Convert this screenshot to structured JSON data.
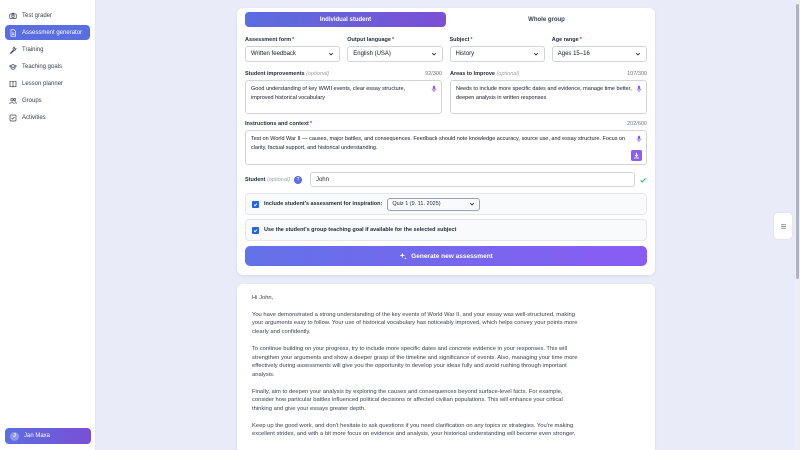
{
  "sidebar": {
    "items": [
      {
        "label": "Test grader",
        "icon": "camera-icon",
        "active": false
      },
      {
        "label": "Assessment generator",
        "icon": "document-icon",
        "active": true
      },
      {
        "label": "Training",
        "icon": "wrench-icon",
        "active": false
      },
      {
        "label": "Teaching goals",
        "icon": "graduation-cap-icon",
        "active": false
      },
      {
        "label": "Lesson planner",
        "icon": "book-icon",
        "active": false
      },
      {
        "label": "Groups",
        "icon": "users-icon",
        "active": false
      },
      {
        "label": "Activities",
        "icon": "checkbox-icon",
        "active": false
      }
    ],
    "user": {
      "initial": "J",
      "name": "Jan Maxa"
    }
  },
  "form": {
    "tabs": [
      {
        "label": "Individual student",
        "active": true
      },
      {
        "label": "Whole group",
        "active": false
      }
    ],
    "assessment_form": {
      "label": "Assessment form",
      "value": "Written feedback"
    },
    "output_language": {
      "label": "Output language",
      "value": "English (USA)"
    },
    "subject": {
      "label": "Subject",
      "value": "History"
    },
    "age_range": {
      "label": "Age range",
      "value": "Ages 15–16"
    },
    "required_mark": "*",
    "optional_mark": "(optional)",
    "improvements": {
      "label": "Student improvements",
      "count": "92/300",
      "value": "Good understanding of key WWII events, clear essay structure, improved historical vocabulary"
    },
    "areas": {
      "label": "Areas to Improve",
      "count": "107/300",
      "value": "Needs to include more specific dates and evidence, manage time better, deepen analysis in written responses"
    },
    "instructions": {
      "label": "Instructions and context",
      "count": "202/600",
      "value": "Test on World War II — causes, major battles, and consequences. Feedback should note knowledge accuracy, source use, and essay structure. Focus on clarity, factual support, and historical understanding."
    },
    "student": {
      "label": "Student",
      "value": "John",
      "help": "?"
    },
    "include_assessment": {
      "label": "Include student's assessment for inspiration:",
      "quiz": "Quiz 1 (9. 11. 2025)"
    },
    "group_goal": {
      "label": "Use the student's group teaching goal if available for the selected subject"
    },
    "generate_label": "Generate new assessment"
  },
  "result": {
    "greeting": "Hi John,",
    "paragraphs": [
      "You have demonstrated a strong understanding of the key events of World War II, and your essay was well-structured, making your arguments easy to follow. Your use of historical vocabulary has noticeably improved, which helps convey your points more clearly and confidently.",
      "To continue building on your progress, try to include more specific dates and concrete evidence in your responses. This will strengthen your arguments and show a deeper grasp of the timeline and significance of events. Also, managing your time more effectively during assessments will give you the opportunity to develop your ideas fully and avoid rushing through important analysis.",
      "Finally, aim to deepen your analysis by exploring the causes and consequences beyond surface-level facts. For example, consider how particular battles influenced political decisions or affected civilian populations. This will enhance your critical thinking and give your essays greater depth.",
      "Keep up the good work, and don't hesitate to ask questions if you need clarification on any topics or strategies. You're making excellent strides, and with a bit more focus on evidence and analysis, your historical understanding will become even stronger."
    ]
  },
  "colors": {
    "accent": "#5b6ee1",
    "accent_end": "#7b4fd4",
    "required": "#dc2626",
    "success": "#22c55e"
  }
}
